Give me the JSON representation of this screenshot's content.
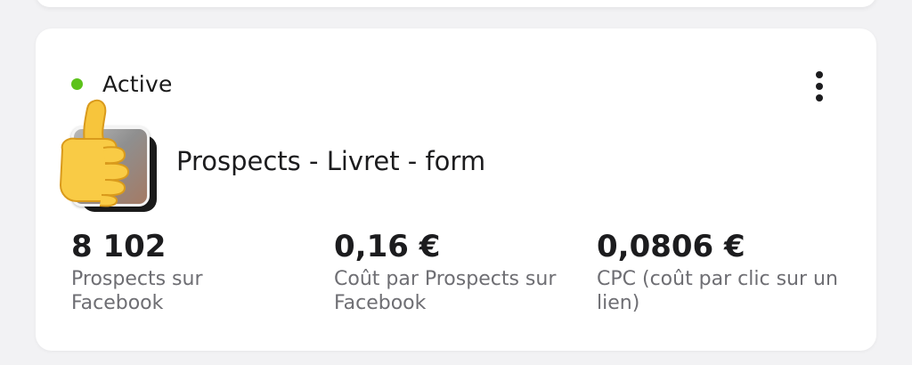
{
  "status": {
    "label": "Active",
    "color": "#5cc21a"
  },
  "menu": {
    "icon": "more-vertical-icon"
  },
  "campaign": {
    "name": "Prospects - Livret - form",
    "thumbnail_icon": "thumbs-up-emoji"
  },
  "metrics": [
    {
      "value": "8 102",
      "label": "Prospects sur Facebook"
    },
    {
      "value": "0,16 €",
      "label": "Coût par Prospects sur Facebook"
    },
    {
      "value": "0,0806 €",
      "label": "CPC (coût par clic sur un lien)"
    }
  ]
}
